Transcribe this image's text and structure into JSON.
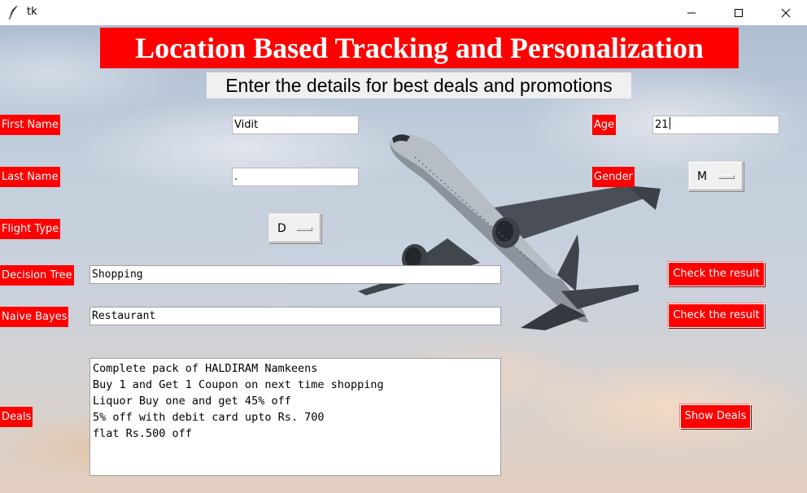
{
  "window": {
    "title": "tk"
  },
  "header": {
    "title": "Location Based Tracking and Personalization",
    "subtitle": "Enter the details for best deals and promotions"
  },
  "form": {
    "first_name": {
      "label": "First Name",
      "value": "Vidit"
    },
    "last_name": {
      "label": "Last Name",
      "value": "."
    },
    "age": {
      "label": "Age",
      "value": "21"
    },
    "gender": {
      "label": "Gender",
      "value": "M"
    },
    "flight_type": {
      "label": "Flight Type",
      "value": "D"
    }
  },
  "results": {
    "decision_tree": {
      "label": "Decision Tree",
      "value": "Shopping",
      "button": "Check the result"
    },
    "naive_bayes": {
      "label": "Naive Bayes",
      "value": "Restaurant",
      "button": "Check the result"
    }
  },
  "deals": {
    "label": "Deals",
    "button": "Show Deals",
    "items": [
      "Complete pack of HALDIRAM Namkeens",
      "Buy 1 and Get 1 Coupon on next time shopping",
      "Liquor Buy one and get 45% off",
      "5% off with debit card upto Rs. 700",
      "flat Rs.500 off"
    ]
  },
  "colors": {
    "label_bg": "#ff0000",
    "label_fg": "#ffffff"
  },
  "icons": {
    "app": "feather-icon",
    "minimize": "minimize-icon",
    "maximize": "maximize-icon",
    "close": "close-icon"
  }
}
